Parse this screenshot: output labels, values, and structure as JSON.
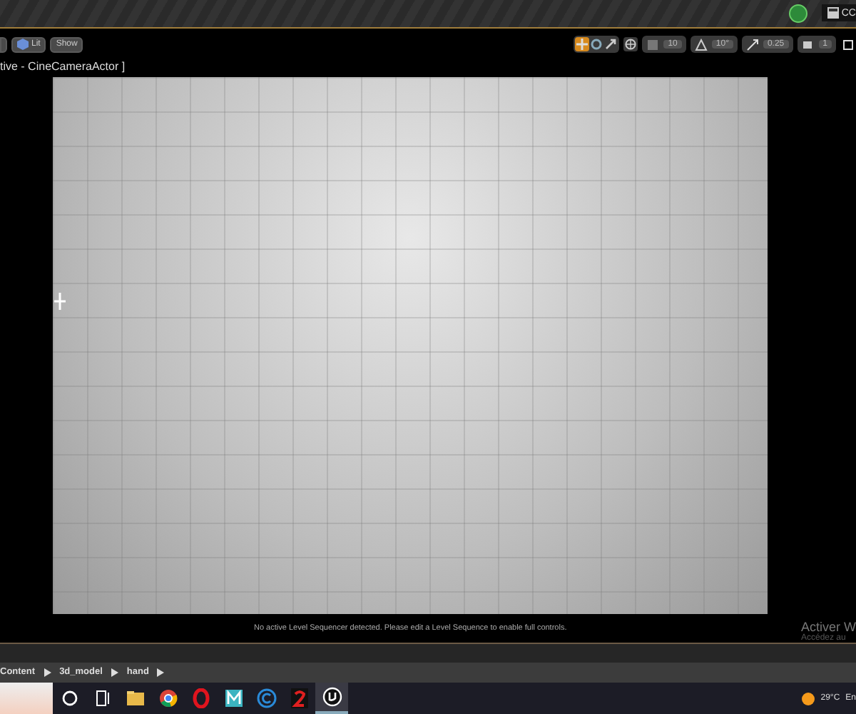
{
  "top_bar": {
    "user_label": "CC"
  },
  "viewport_toolbar": {
    "view_buttons": [
      {
        "kind": "lit",
        "label": "Lit"
      },
      {
        "kind": "plain",
        "label": "Show"
      }
    ],
    "transform_tools": [
      {
        "kind": "move",
        "selected": true
      },
      {
        "kind": "rotate",
        "selected": false
      },
      {
        "kind": "scale",
        "selected": false
      }
    ],
    "snaps": [
      {
        "kind": "grid",
        "value": "10"
      },
      {
        "kind": "rotation",
        "value": "10°"
      },
      {
        "kind": "scale",
        "value": "0.25"
      },
      {
        "kind": "camera",
        "value": "1"
      }
    ]
  },
  "viewport": {
    "label": "tive - CineCameraActor ]",
    "status_message": "No active Level Sequencer detected. Please edit a Level Sequence to enable full controls."
  },
  "activation_notice": {
    "title": "Activer W",
    "subtitle": "Accédez au"
  },
  "breadcrumbs": [
    "Content",
    "3d_model",
    "hand"
  ],
  "taskbar": {
    "apps": [
      {
        "kind": "search",
        "selected": false
      },
      {
        "kind": "taskview",
        "selected": false
      },
      {
        "kind": "folder",
        "selected": false
      },
      {
        "kind": "chrome",
        "selected": false
      },
      {
        "kind": "opera",
        "selected": false
      },
      {
        "kind": "m",
        "selected": false
      },
      {
        "kind": "c",
        "selected": false
      },
      {
        "kind": "two",
        "selected": false
      },
      {
        "kind": "unreal",
        "selected": true
      }
    ],
    "temperature": "29°C",
    "language": "En"
  }
}
